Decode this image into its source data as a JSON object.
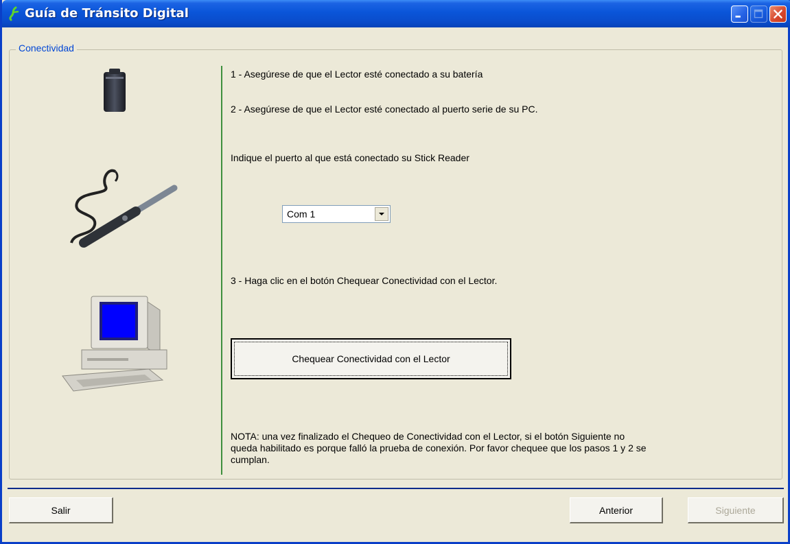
{
  "window": {
    "title": "Guía de Tránsito Digital",
    "controls": [
      "minimize",
      "maximize",
      "close"
    ]
  },
  "group": {
    "label": "Conectividad"
  },
  "steps": {
    "step1": "1 - Asegúrese de que el Lector esté conectado a su batería",
    "step2": "2 - Asegúrese de que el Lector esté conectado al puerto serie de su PC.",
    "port_prompt": "Indique el puerto al que está conectado su Stick Reader",
    "step3": "3 - Haga clic en el botón Chequear Conectividad con el Lector."
  },
  "port_select": {
    "value": "Com 1"
  },
  "check_button": {
    "label": "Chequear Conectividad con el Lector"
  },
  "note": {
    "line1": "NOTA: una vez finalizado el Chequeo de Conectividad con el Lector, si el botón Siguiente no",
    "line2": "queda habilitado es porque falló la prueba de conexión. Por favor chequee que los pasos 1 y 2 se",
    "line3": "cumplan."
  },
  "footer": {
    "exit_label": "Salir",
    "back_label": "Anterior",
    "next_label": "Siguiente",
    "next_enabled": false
  },
  "icons": {
    "app": "app-logo-icon",
    "battery": "battery-icon",
    "reader": "stick-reader-icon",
    "computer": "computer-icon"
  },
  "colors": {
    "titlebar": "#0a55d9",
    "window_bg": "#ece9d8",
    "divider": "#3d8f3d",
    "legend": "#0046d5",
    "disabled_text": "#aca899"
  }
}
